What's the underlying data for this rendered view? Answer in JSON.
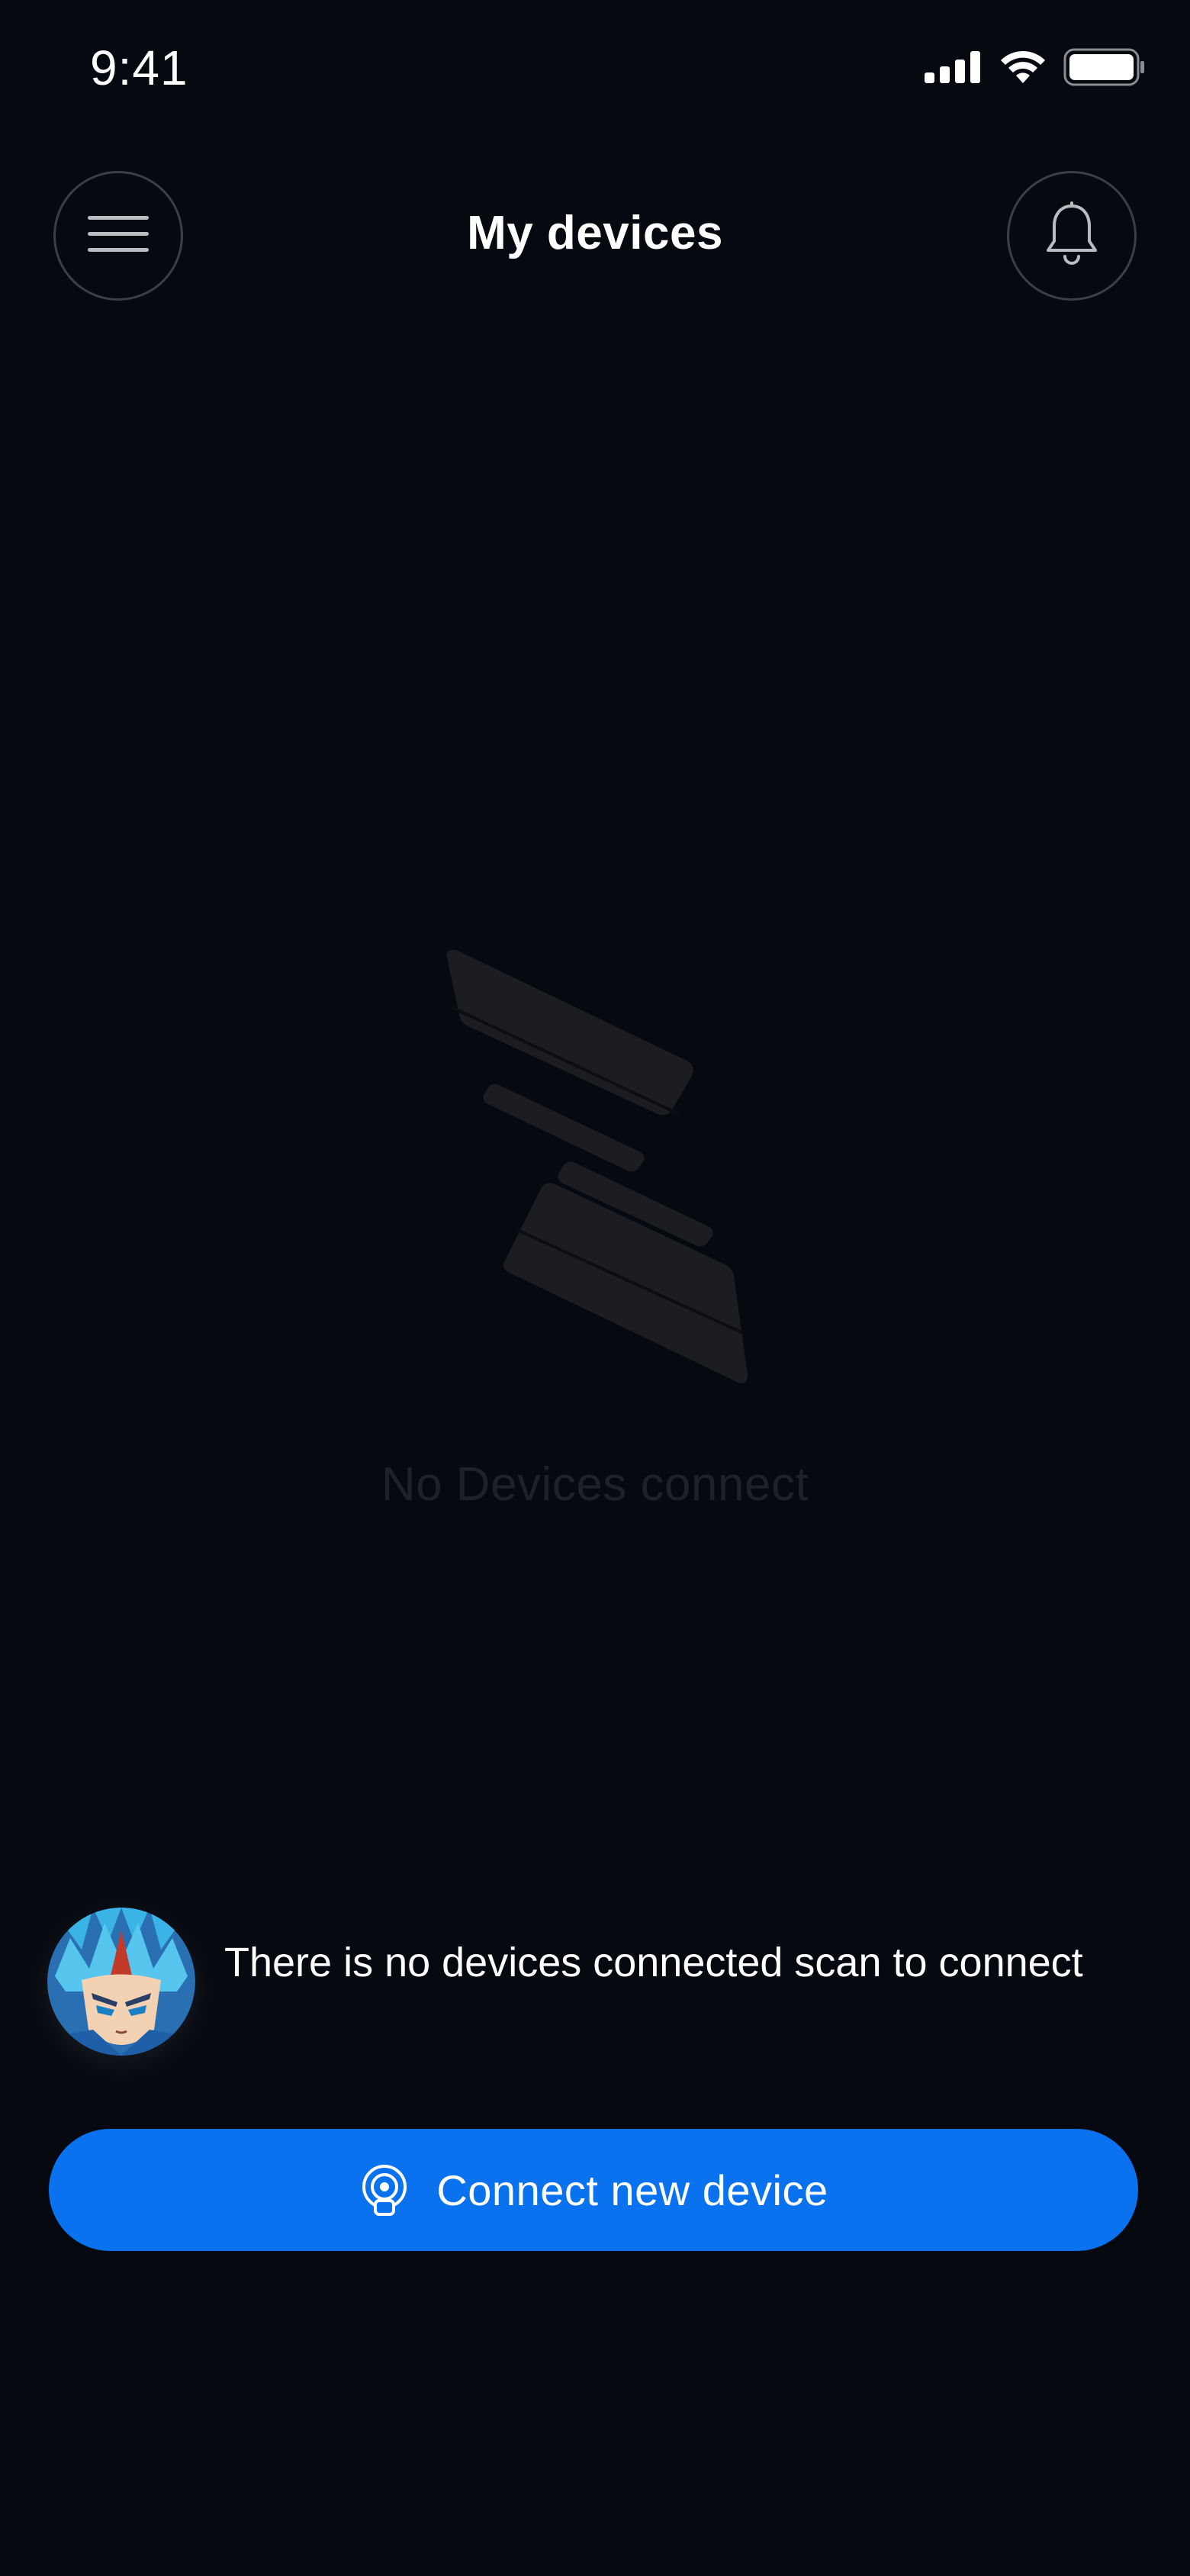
{
  "status_bar": {
    "time": "9:41",
    "icons": [
      "signal-icon",
      "wifi-icon",
      "battery-icon"
    ]
  },
  "header": {
    "title": "My devices",
    "menu_icon": "hamburger-menu-icon",
    "notifications_icon": "bell-icon"
  },
  "empty_state": {
    "icon": "empty-devices-logo-icon",
    "message": "No Devices connect"
  },
  "assistant": {
    "message": "There is no devices connected scan to connect"
  },
  "primary_action": {
    "label": "Connect new device",
    "icon": "scan-signal-icon"
  },
  "colors": {
    "background": "#060a10",
    "accent": "#0a72ef",
    "header_border": "#3a3e45",
    "muted_text": "#1e2228",
    "logo_shape": "#1c1d20"
  }
}
